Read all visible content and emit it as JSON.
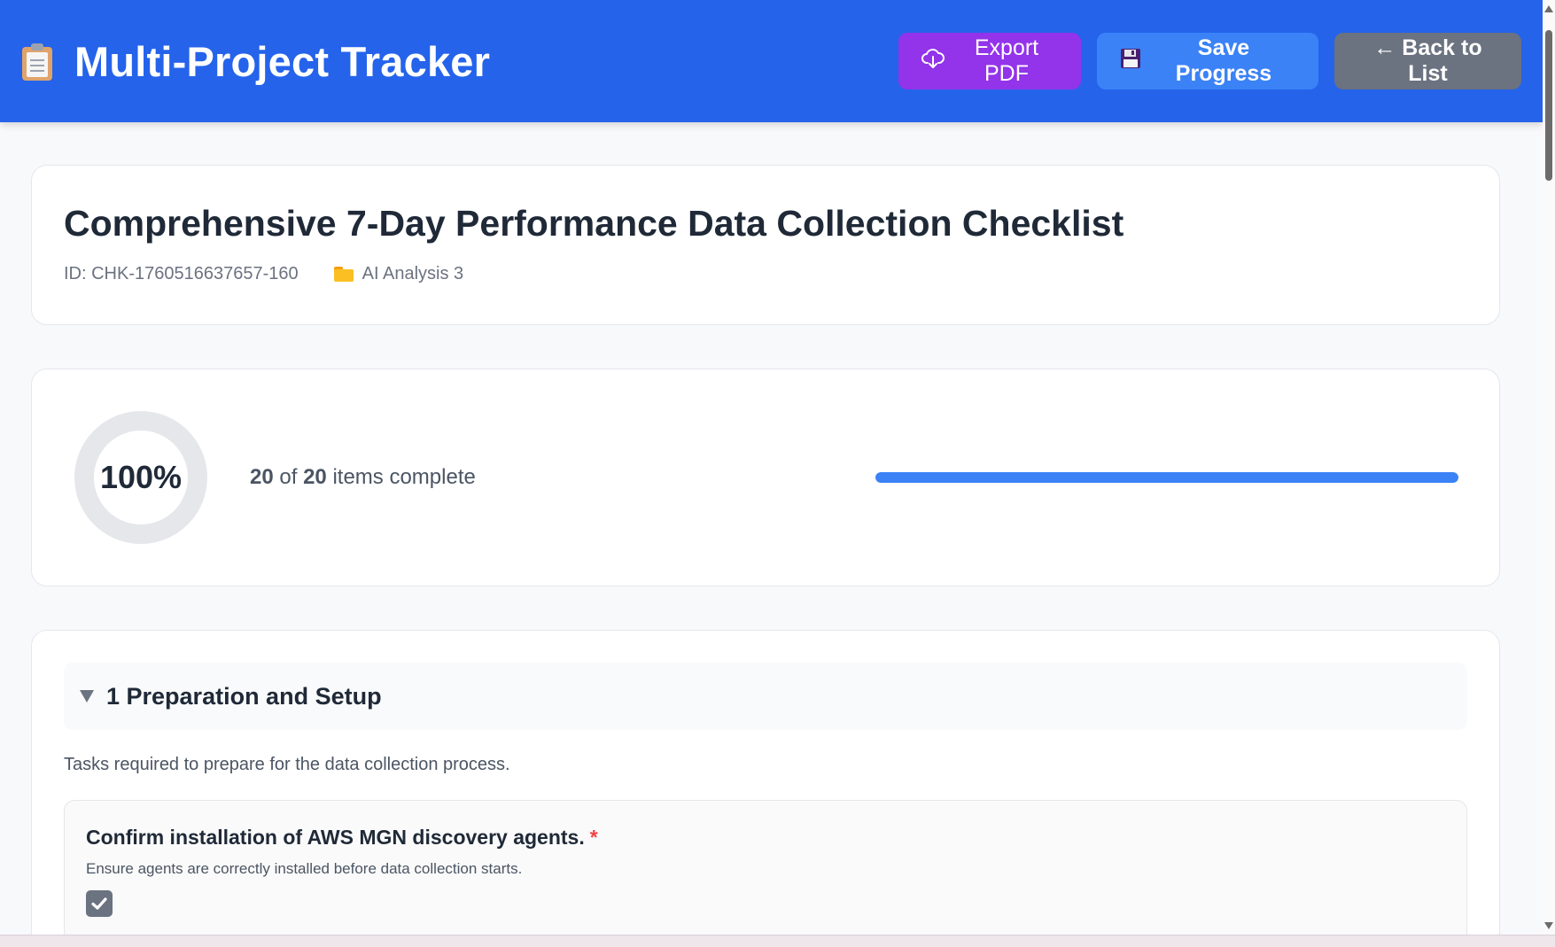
{
  "header": {
    "title": "Multi-Project Tracker",
    "export_label": "Export PDF",
    "save_label": "Save Progress",
    "back_label": "← Back to List"
  },
  "checklist": {
    "title": "Comprehensive 7-Day Performance Data Collection Checklist",
    "id_text": "ID: CHK-1760516637657-160",
    "project": "AI Analysis 3"
  },
  "progress": {
    "percent_label": "100%",
    "completed": "20",
    "of_text": "of",
    "total": "20",
    "suffix": "items complete",
    "fraction": 1.0
  },
  "section": {
    "title": "1 Preparation and Setup",
    "description": "Tasks required to prepare for the data collection process.",
    "items": [
      {
        "title": "Confirm installation of AWS MGN discovery agents.",
        "required_mark": "*",
        "description": "Ensure agents are correctly installed before data collection starts.",
        "checked": true
      }
    ]
  },
  "colors": {
    "header_bg": "#2563eb",
    "export_btn": "#9333ea",
    "save_btn": "#3b82f6",
    "back_btn": "#6b7280",
    "progress_fill": "#3b82f6"
  }
}
